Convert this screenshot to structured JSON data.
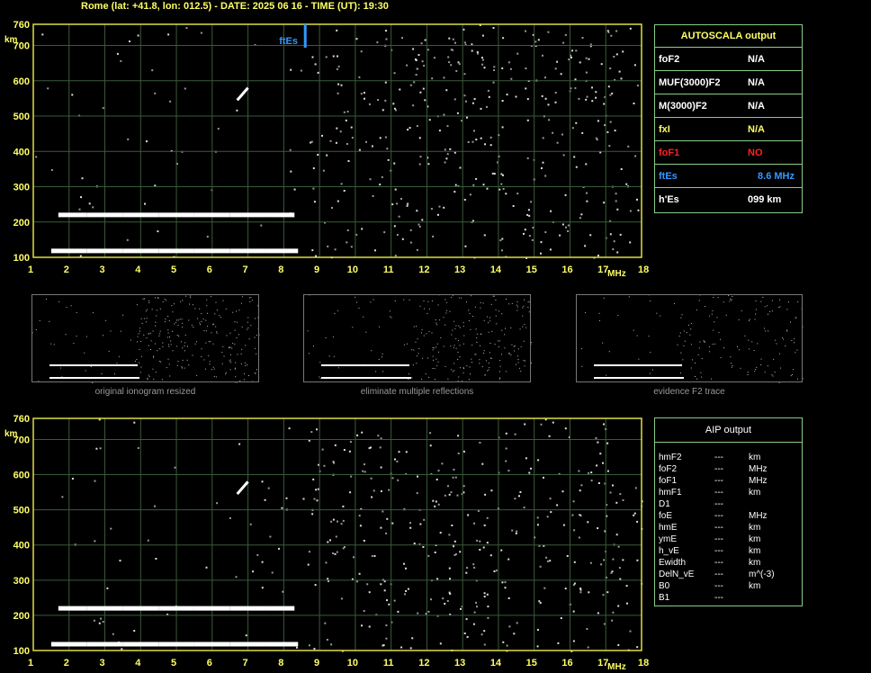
{
  "header": "Rome (lat: +41.8, lon: 012.5) - DATE: 2025 06 16 - TIME (UT): 19:30",
  "autoscala": {
    "title": "AUTOSCALA output",
    "rows": [
      {
        "key": "foF2",
        "value": "N/A",
        "color": "#ffffff"
      },
      {
        "key": "MUF(3000)F2",
        "value": "N/A",
        "color": "#ffffff"
      },
      {
        "key": "M(3000)F2",
        "value": "N/A",
        "color": "#ffffff"
      },
      {
        "key": "fxI",
        "value": "N/A",
        "color": "#ffff66"
      },
      {
        "key": "foF1",
        "value": "NO",
        "color": "#ff2020"
      },
      {
        "key": "ftEs",
        "value": "8.6 MHz",
        "color": "#3399ff"
      },
      {
        "key": "h'Es",
        "value": "099     km",
        "color": "#ffffff"
      }
    ]
  },
  "aip": {
    "title": "AIP output",
    "rows": [
      {
        "key": "hmF2",
        "dash": "---",
        "unit": "km"
      },
      {
        "key": "foF2",
        "dash": "---",
        "unit": "MHz"
      },
      {
        "key": "foF1",
        "dash": "---",
        "unit": "MHz"
      },
      {
        "key": "hmF1",
        "dash": "---",
        "unit": "km"
      },
      {
        "key": "D1",
        "dash": "---",
        "unit": ""
      },
      {
        "key": "foE",
        "dash": "---",
        "unit": "MHz"
      },
      {
        "key": "hmE",
        "dash": "---",
        "unit": "km"
      },
      {
        "key": "ymE",
        "dash": "---",
        "unit": "km"
      },
      {
        "key": "h_vE",
        "dash": "---",
        "unit": "km"
      },
      {
        "key": "Ewidth",
        "dash": "---",
        "unit": "km"
      },
      {
        "key": "DelN_vE",
        "dash": "---",
        "unit": "m^(-3)"
      },
      {
        "key": "B0",
        "dash": "---",
        "unit": "km"
      },
      {
        "key": "B1",
        "dash": "---",
        "unit": ""
      }
    ]
  },
  "captions": [
    "original ionogram resized",
    "eliminate multiple reflections",
    "evidence F2 trace"
  ],
  "chart_data": [
    {
      "type": "scatter",
      "xlim": [
        1,
        18
      ],
      "ylim": [
        100,
        760
      ],
      "xticks": [
        "1",
        "2",
        "3",
        "4",
        "5",
        "6",
        "7",
        "8",
        "9",
        "10",
        "11",
        "12",
        "13",
        "14",
        "15",
        "16",
        "17",
        "18"
      ],
      "yticks": [
        "100",
        "200",
        "300",
        "400",
        "500",
        "600",
        "700",
        "760"
      ],
      "xunit": "MHz",
      "yunit": "km",
      "marker": {
        "label": "ftEs",
        "x": 8.6,
        "color": "#3399ff"
      },
      "series": [
        {
          "name": "",
          "values": [
            [
              1.5,
              118
            ],
            [
              2.5,
              118
            ],
            [
              3.5,
              118
            ],
            [
              4.5,
              118
            ],
            [
              5.5,
              118
            ],
            [
              6.5,
              118
            ],
            [
              7.5,
              118
            ],
            [
              8.4,
              118
            ]
          ],
          "style": "trace"
        },
        {
          "name": "",
          "values": [
            [
              1.7,
              220
            ],
            [
              2.5,
              220
            ],
            [
              3.5,
              220
            ],
            [
              4.5,
              220
            ],
            [
              5.5,
              220
            ],
            [
              6.5,
              220
            ],
            [
              7.5,
              220
            ],
            [
              8.3,
              220
            ]
          ],
          "style": "trace"
        }
      ],
      "grid": true
    },
    {
      "type": "scatter",
      "xlim": [
        1,
        18
      ],
      "ylim": [
        100,
        760
      ],
      "xticks": [
        "1",
        "2",
        "3",
        "4",
        "5",
        "6",
        "7",
        "8",
        "9",
        "10",
        "11",
        "12",
        "13",
        "14",
        "15",
        "16",
        "17",
        "18"
      ],
      "yticks": [
        "100",
        "200",
        "300",
        "400",
        "500",
        "600",
        "700",
        "760"
      ],
      "xunit": "MHz",
      "yunit": "km",
      "series": [
        {
          "name": "",
          "values": [
            [
              1.5,
              118
            ],
            [
              2.5,
              118
            ],
            [
              3.5,
              118
            ],
            [
              4.5,
              118
            ],
            [
              5.5,
              118
            ],
            [
              6.5,
              118
            ],
            [
              7.5,
              118
            ],
            [
              8.4,
              118
            ]
          ],
          "style": "trace"
        },
        {
          "name": "",
          "values": [
            [
              1.7,
              220
            ],
            [
              2.5,
              220
            ],
            [
              3.5,
              220
            ],
            [
              4.5,
              220
            ],
            [
              5.5,
              220
            ],
            [
              6.5,
              220
            ],
            [
              7.5,
              220
            ],
            [
              8.3,
              220
            ]
          ],
          "style": "trace"
        }
      ],
      "grid": true
    }
  ]
}
